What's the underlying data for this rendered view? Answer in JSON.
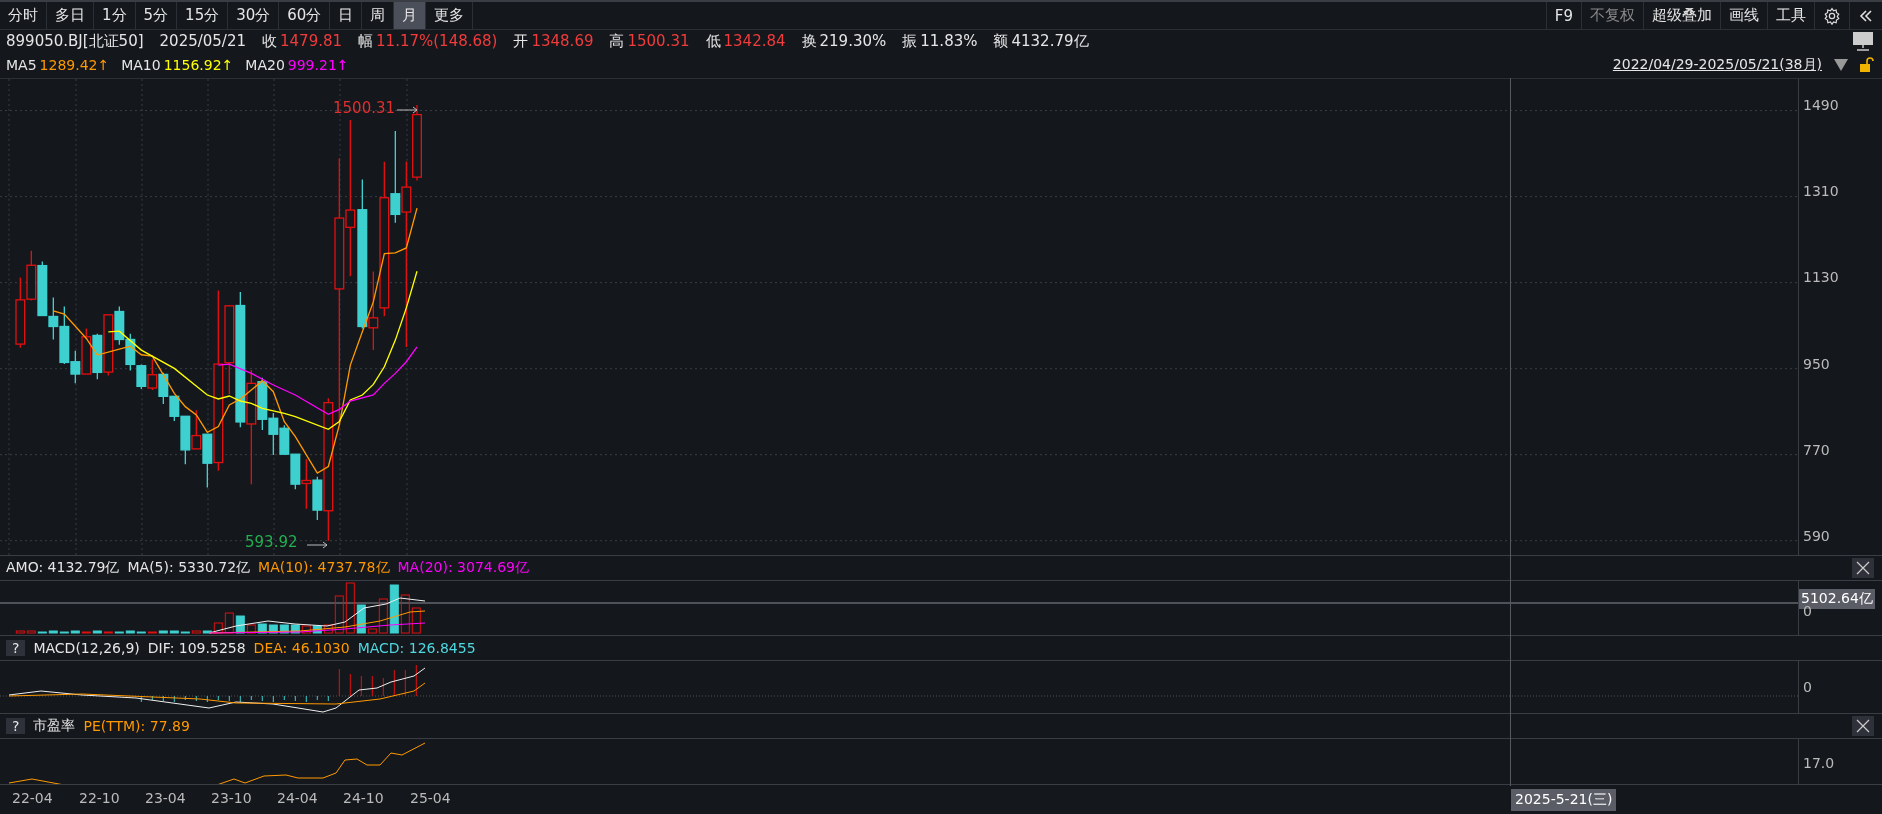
{
  "toolbar": {
    "periods": [
      {
        "label": "分时",
        "selected": false
      },
      {
        "label": "多日",
        "selected": false
      },
      {
        "label": "1分",
        "selected": false
      },
      {
        "label": "5分",
        "selected": false
      },
      {
        "label": "15分",
        "selected": false
      },
      {
        "label": "30分",
        "selected": false
      },
      {
        "label": "60分",
        "selected": false
      },
      {
        "label": "日",
        "selected": false
      },
      {
        "label": "周",
        "selected": false
      },
      {
        "label": "月",
        "selected": true
      },
      {
        "label": "更多",
        "selected": false
      }
    ],
    "tools": [
      {
        "label": "F9",
        "disabled": false
      },
      {
        "label": "不复权",
        "disabled": true
      },
      {
        "label": "超级叠加",
        "disabled": false
      },
      {
        "label": "画线",
        "disabled": false
      },
      {
        "label": "工具",
        "disabled": false
      }
    ]
  },
  "quote": {
    "code": "899050.BJ[北证50]",
    "date": "2025/05/21",
    "fields": [
      {
        "label": "收",
        "value": "1479.81",
        "color": "#f23b3b"
      },
      {
        "label": "幅",
        "value": "11.17%(148.68)",
        "color": "#f23b3b"
      },
      {
        "label": "开",
        "value": "1348.69",
        "color": "#f23b3b"
      },
      {
        "label": "高",
        "value": "1500.31",
        "color": "#f23b3b"
      },
      {
        "label": "低",
        "value": "1342.84",
        "color": "#f23b3b"
      },
      {
        "label": "换",
        "value": "219.30%",
        "color": "#e6e6e6"
      },
      {
        "label": "振",
        "value": "11.83%",
        "color": "#e6e6e6"
      },
      {
        "label": "额",
        "value": "4132.79亿",
        "color": "#e6e6e6"
      }
    ]
  },
  "ma_legend": [
    {
      "label": "MA5",
      "value": "1289.42↑",
      "color": "#ff9900"
    },
    {
      "label": "MA10",
      "value": "1156.92↑",
      "color": "#ffff00"
    },
    {
      "label": "MA20",
      "value": "999.21↑",
      "color": "#ff00ff"
    }
  ],
  "range": "2022/04/29-2025/05/21(38月)",
  "price_chart": {
    "ticks": [
      "1490",
      "1310",
      "1130",
      "950",
      "770",
      "590"
    ],
    "high_label": "1500.31",
    "low_label": "593.92"
  },
  "volume": {
    "legend": [
      {
        "text": "AMO: 4132.79亿",
        "color": "#e6e6e6"
      },
      {
        "text": "MA(5): 5330.72亿",
        "color": "#e6e6e6"
      },
      {
        "text": "MA(10): 4737.78亿",
        "color": "#ff9900"
      },
      {
        "text": "MA(20): 3074.69亿",
        "color": "#ff00ff"
      }
    ],
    "marker": "5102.64亿",
    "ticks": [
      "0"
    ]
  },
  "macd": {
    "help": "?",
    "legend": [
      {
        "text": "MACD(12,26,9)",
        "color": "#e6e6e6"
      },
      {
        "text": "DIF: 109.5258",
        "color": "#e6e6e6"
      },
      {
        "text": "DEA: 46.1030",
        "color": "#ff9900"
      },
      {
        "text": "MACD: 126.8455",
        "color": "#4fd8e0"
      }
    ],
    "ticks": [
      "0"
    ]
  },
  "pe": {
    "help": "?",
    "legend": [
      {
        "text": "市盈率",
        "color": "#e6e6e6"
      },
      {
        "text": "PE(TTM): 77.89",
        "color": "#ff9900"
      }
    ],
    "ticks": [
      "17.0"
    ]
  },
  "x_axis": {
    "labels": [
      "22-04",
      "22-10",
      "23-04",
      "23-10",
      "24-04",
      "24-10",
      "25-04"
    ],
    "cursor_date": "2025-5-21(三)"
  }
}
